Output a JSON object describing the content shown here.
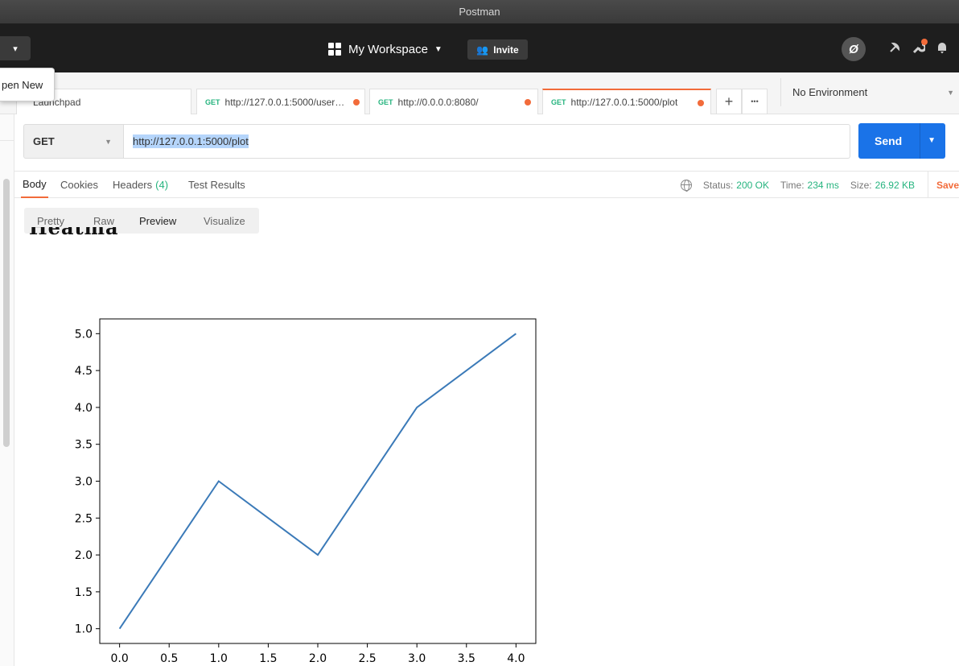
{
  "app": {
    "title": "Postman"
  },
  "header": {
    "new_caret": "▾",
    "workspace_label": "My Workspace",
    "workspace_caret": "▼",
    "invite_label": "Invite",
    "invite_icon": "👥",
    "sync_icon": "Ø"
  },
  "tooltip": {
    "text": "pen New"
  },
  "tabs": [
    {
      "method": "",
      "label": "Launchpad",
      "modified": false
    },
    {
      "method": "GET",
      "label": "http://127.0.0.1:5000/user…",
      "modified": true
    },
    {
      "method": "GET",
      "label": "http://0.0.0.0:8080/",
      "modified": true
    },
    {
      "method": "GET",
      "label": "http://127.0.0.1:5000/plot",
      "modified": true,
      "active": true
    }
  ],
  "tab_controls": {
    "add": "+",
    "more": "•••"
  },
  "environment": {
    "selected": "No Environment",
    "caret": "▼"
  },
  "request": {
    "method": "GET",
    "method_caret": "▼",
    "url": "http://127.0.0.1:5000/plot",
    "send_label": "Send",
    "send_caret": "▼"
  },
  "response_tabs": {
    "body": "Body",
    "cookies": "Cookies",
    "headers": "Headers",
    "headers_count": "(4)",
    "tests": "Test Results"
  },
  "status_bar": {
    "status_label": "Status:",
    "status_value": "200 OK",
    "time_label": "Time:",
    "time_value": "234 ms",
    "size_label": "Size:",
    "size_value": "26.92 KB",
    "save_label": "Save"
  },
  "view_modes": {
    "pretty": "Pretty",
    "raw": "Raw",
    "preview": "Preview",
    "visualize": "Visualize",
    "selected": "Preview"
  },
  "preview": {
    "heading": "Heatmap"
  },
  "colors": {
    "accent": "#f26b3a",
    "send": "#1a73e8",
    "success": "#26b47f",
    "line": "#3b7ab8"
  },
  "chart_data": {
    "type": "line",
    "x": [
      0,
      1,
      2,
      3,
      4
    ],
    "series": [
      {
        "values": [
          1,
          3,
          2,
          4,
          5
        ]
      }
    ],
    "xlim": [
      -0.2,
      4.2
    ],
    "ylim": [
      0.8,
      5.2
    ],
    "xticks": [
      "0.0",
      "0.5",
      "1.0",
      "1.5",
      "2.0",
      "2.5",
      "3.0",
      "3.5",
      "4.0"
    ],
    "yticks": [
      "1.0",
      "1.5",
      "2.0",
      "2.5",
      "3.0",
      "3.5",
      "4.0",
      "4.5",
      "5.0"
    ],
    "title": "",
    "xlabel": "",
    "ylabel": "",
    "grid": false
  }
}
